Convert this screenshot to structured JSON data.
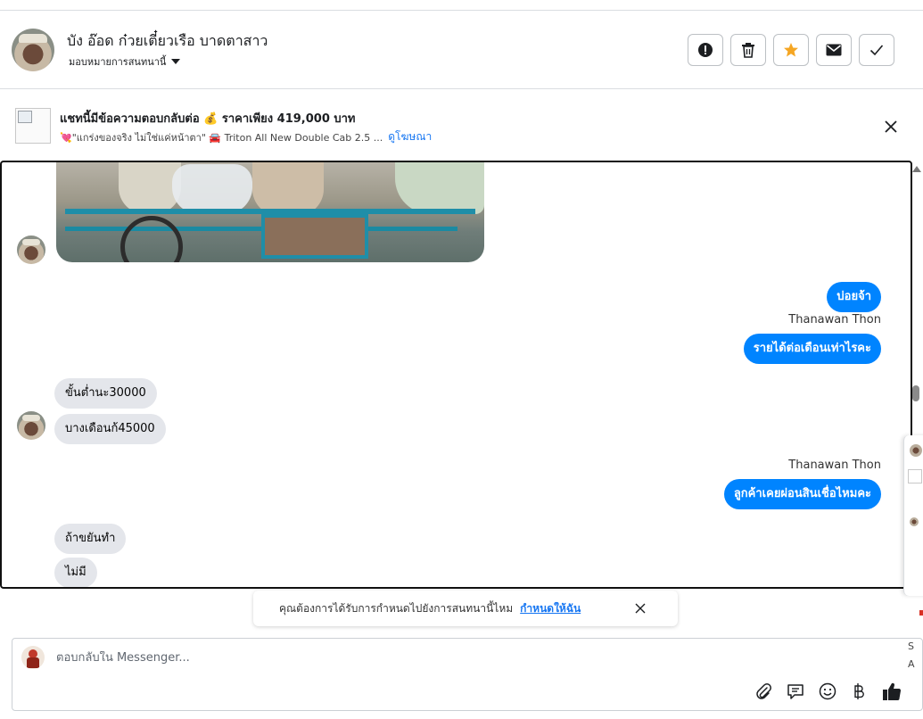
{
  "header": {
    "contact_name": "บัง อ๊อด ก๋วยเตี๋ยวเรือ บาดตาสาว",
    "assign_label": "มอบหมายการสนทนานี้",
    "actions": [
      "mark-spam",
      "delete",
      "star",
      "mark-unread",
      "mark-done"
    ]
  },
  "ad": {
    "title": "แชทนี้มีข้อความตอบกลับต่อ 💰 ราคาเพียง 419,000 บาท",
    "description": "💘\"แกร่งของจริง ไม่ใช่แค่หน้าตา\" 🚘 Triton All New Double Cab 2.5 ...",
    "link_label": "ดูโฆษณา"
  },
  "messages": [
    {
      "direction": "out",
      "text": "บ่อยจ้า"
    },
    {
      "direction": "out",
      "sender": "Thanawan Thon",
      "text": "รายได้ต่อเดือนเท่าไรคะ"
    },
    {
      "direction": "in",
      "text": "ขั้นต่ำนะ30000"
    },
    {
      "direction": "in",
      "text": "บางเดือนก้45000"
    },
    {
      "direction": "out",
      "sender": "Thanawan Thon",
      "text": "ลูกค้าเคยผ่อนสินเชื่อไหมคะ"
    },
    {
      "direction": "in",
      "text": "ถ้าขยันทำ"
    },
    {
      "direction": "in",
      "text": "ไม่มี"
    }
  ],
  "suggestion": {
    "text": "คุณต้องการได้รับการกำหนดไปยังการสนทนานี้ไหม",
    "link_label": "กำหนดให้ฉัน"
  },
  "composer": {
    "placeholder": "ตอบกลับใน Messenger...",
    "tools": [
      "attachment-icon",
      "saved-reply-icon",
      "emoji-icon",
      "baht-icon",
      "like-icon"
    ]
  },
  "side_panel": {
    "fragments": [
      "S",
      "A"
    ]
  },
  "colors": {
    "outgoing_bubble": "#0084ff",
    "incoming_bubble": "#e4e6eb",
    "star": "#f5a623",
    "link": "#1877f2"
  }
}
